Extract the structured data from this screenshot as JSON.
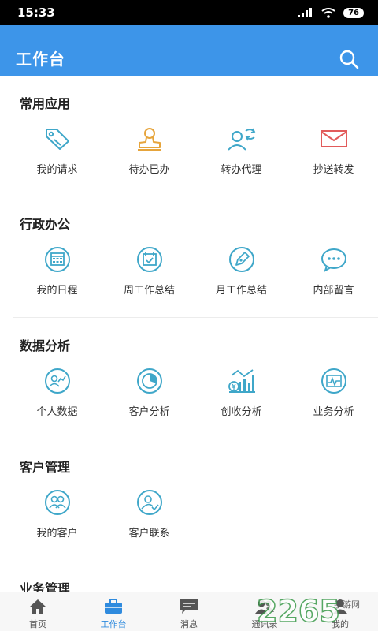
{
  "status_bar": {
    "time": "15:33",
    "battery": "76"
  },
  "app_bar": {
    "title": "工作台"
  },
  "sections": [
    {
      "title": "常用应用",
      "items": [
        {
          "label": "我的请求",
          "icon": "tag-icon"
        },
        {
          "label": "待办已办",
          "icon": "stamp-icon"
        },
        {
          "label": "转办代理",
          "icon": "transfer-user-icon"
        },
        {
          "label": "抄送转发",
          "icon": "mail-icon"
        }
      ]
    },
    {
      "title": "行政办公",
      "items": [
        {
          "label": "我的日程",
          "icon": "calendar-grid-icon"
        },
        {
          "label": "周工作总结",
          "icon": "calendar-check-icon"
        },
        {
          "label": "月工作总结",
          "icon": "pen-icon"
        },
        {
          "label": "内部留言",
          "icon": "chat-icon"
        }
      ]
    },
    {
      "title": "数据分析",
      "items": [
        {
          "label": "个人数据",
          "icon": "person-chart-icon"
        },
        {
          "label": "客户分析",
          "icon": "pie-chart-icon"
        },
        {
          "label": "创收分析",
          "icon": "revenue-chart-icon"
        },
        {
          "label": "业务分析",
          "icon": "line-chart-icon"
        }
      ]
    },
    {
      "title": "客户管理",
      "items": [
        {
          "label": "我的客户",
          "icon": "group-icon"
        },
        {
          "label": "客户联系",
          "icon": "user-contact-icon"
        }
      ]
    },
    {
      "title": "业务管理",
      "items": []
    }
  ],
  "bottom_nav": [
    {
      "label": "首页",
      "icon": "home-icon"
    },
    {
      "label": "工作台",
      "icon": "briefcase-icon",
      "active": true
    },
    {
      "label": "消息",
      "icon": "message-icon"
    },
    {
      "label": "通讯录",
      "icon": "contacts-icon"
    },
    {
      "label": "我的",
      "icon": "user-icon"
    }
  ],
  "watermark": {
    "text": "2265",
    "sub": "手游网"
  },
  "colors": {
    "primary": "#3d95e9",
    "icon_teal": "#3fa7c9",
    "icon_orange": "#e6a43b",
    "icon_red": "#e25b5b"
  }
}
